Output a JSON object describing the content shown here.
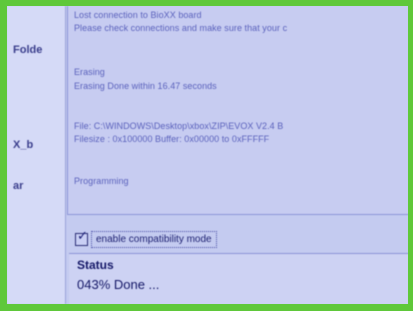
{
  "sidebar": {
    "items": [
      {
        "label": "Folde"
      },
      {
        "label": "X_b"
      },
      {
        "label": "ar"
      }
    ]
  },
  "log": {
    "lines": [
      "Lost connection to BioXX board",
      "Please check connections and make sure that your c",
      "Erasing",
      "Erasing Done within 16.47 seconds",
      "File: C:\\WINDOWS\\Desktop\\xbox\\ZIP\\EVOX V2.4 B",
      "Filesize : 0x100000    Buffer: 0x00000 to 0xFFFFF",
      "Programming"
    ]
  },
  "options": {
    "compat_label": "enable compatibility mode",
    "compat_checked": true
  },
  "status": {
    "title": "Status",
    "text": "043% Done ...",
    "progress_percent": 43
  }
}
